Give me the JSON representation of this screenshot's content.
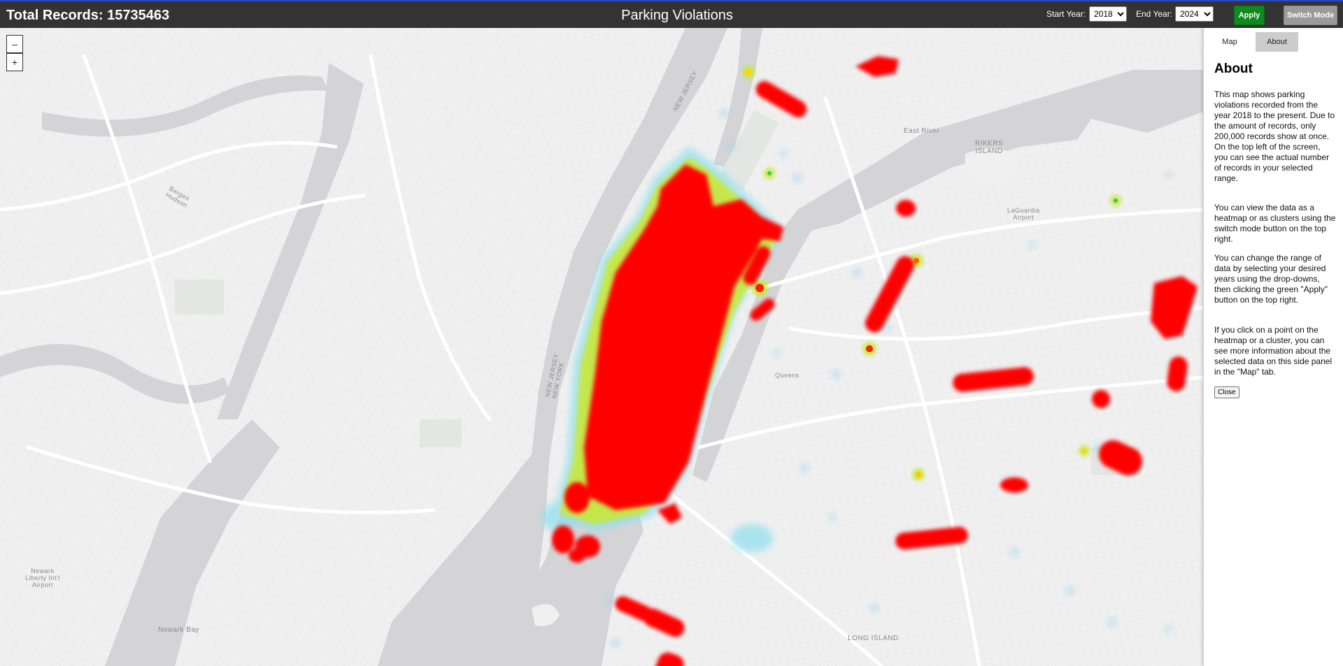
{
  "header": {
    "total_records": "Total Records: 15735463",
    "title": "Parking Violations",
    "start_year_label": "Start Year:",
    "start_year_value": "2018",
    "end_year_label": "End Year:",
    "end_year_value": "2024",
    "apply_label": "Apply",
    "switch_mode_label": "Switch Mode"
  },
  "map": {
    "zoom_out_label": "–",
    "zoom_in_label": "+",
    "place_labels": {
      "east_river": "East River",
      "rikers_island": "RIKERS\nISLAND",
      "laguardia": "LaGuardia\nAirport",
      "bergen_hudson": "Bergen\nHudson",
      "new_jersey_top": "NEW JERSEY",
      "new_jersey_new_york": "NEW JERSEY\nNEW YORK",
      "newark_airport": "Newark\nLiberty Int'l\nAirport",
      "newark_bay": "Newark Bay",
      "long_island": "LONG ISLAND",
      "queens": "Queens"
    },
    "colors": {
      "water": "#d4d4d6",
      "land": "#f0f0f0",
      "heat_core": "#ff0000",
      "heat_edge_1": "#c9e83a",
      "heat_edge_2": "#8ce0ee"
    }
  },
  "side_panel": {
    "tabs": [
      {
        "label": "Map",
        "active": false
      },
      {
        "label": "About",
        "active": true
      }
    ],
    "about_heading": "About",
    "paragraphs": [
      "This map shows parking violations recorded from the year 2018 to the present. Due to the amount of records, only 200,000 records show at once. On the top left of the screen, you can see the actual number of records in your selected range.",
      "You can view the data as a heatmap or as clusters using the switch mode button on the top right.",
      "You can change the range of data by selecting your desired years using the drop-downs, then clicking the green \"Apply\" button on the top right.",
      "If you click on a point on the heatmap or a cluster, you can see more information about the selected data on this side panel in the \"Map\" tab."
    ],
    "close_label": "Close"
  }
}
